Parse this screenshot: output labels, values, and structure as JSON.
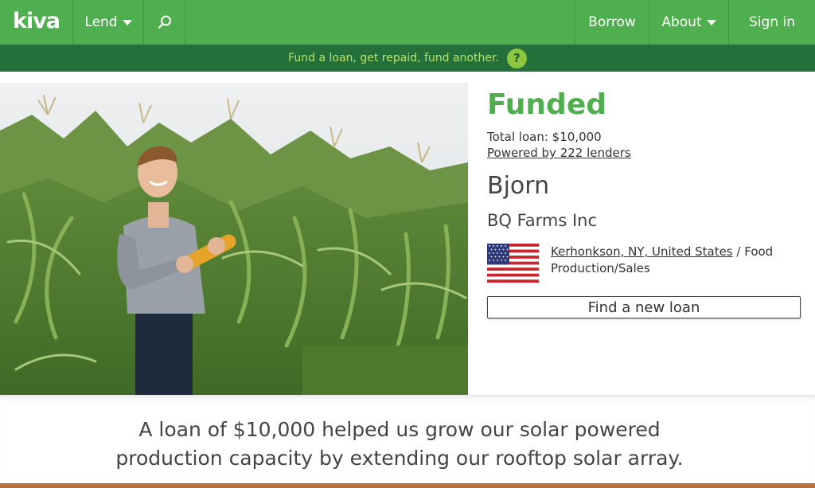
{
  "nav": {
    "logo": "kiva",
    "lend_label": "Lend",
    "borrow_label": "Borrow",
    "about_label": "About",
    "signin_label": "Sign in"
  },
  "banner": {
    "text": "Fund a loan, get repaid, fund another.",
    "help_label": "?"
  },
  "loan": {
    "status": "Funded",
    "total": "Total loan: $10,000",
    "lenders": "Powered by 222 lenders",
    "borrower_name": "Bjorn",
    "business_name": "BQ Farms Inc",
    "location": "Kerhonkson, NY, United States",
    "location_separator": " / Food",
    "sector_line2": "Production/Sales",
    "find_button": "Find a new loan"
  },
  "story": {
    "line1": "A loan of $10,000 helped us grow our solar powered",
    "line2": "production capacity by extending our rooftop solar array."
  },
  "colors": {
    "kiva_green": "#4faf4e",
    "banner_dark_green": "#23703a",
    "banner_text": "#b6e46a"
  },
  "icons": {
    "search": "search-icon",
    "caret": "chevron-down-icon",
    "flag": "us-flag-icon"
  }
}
